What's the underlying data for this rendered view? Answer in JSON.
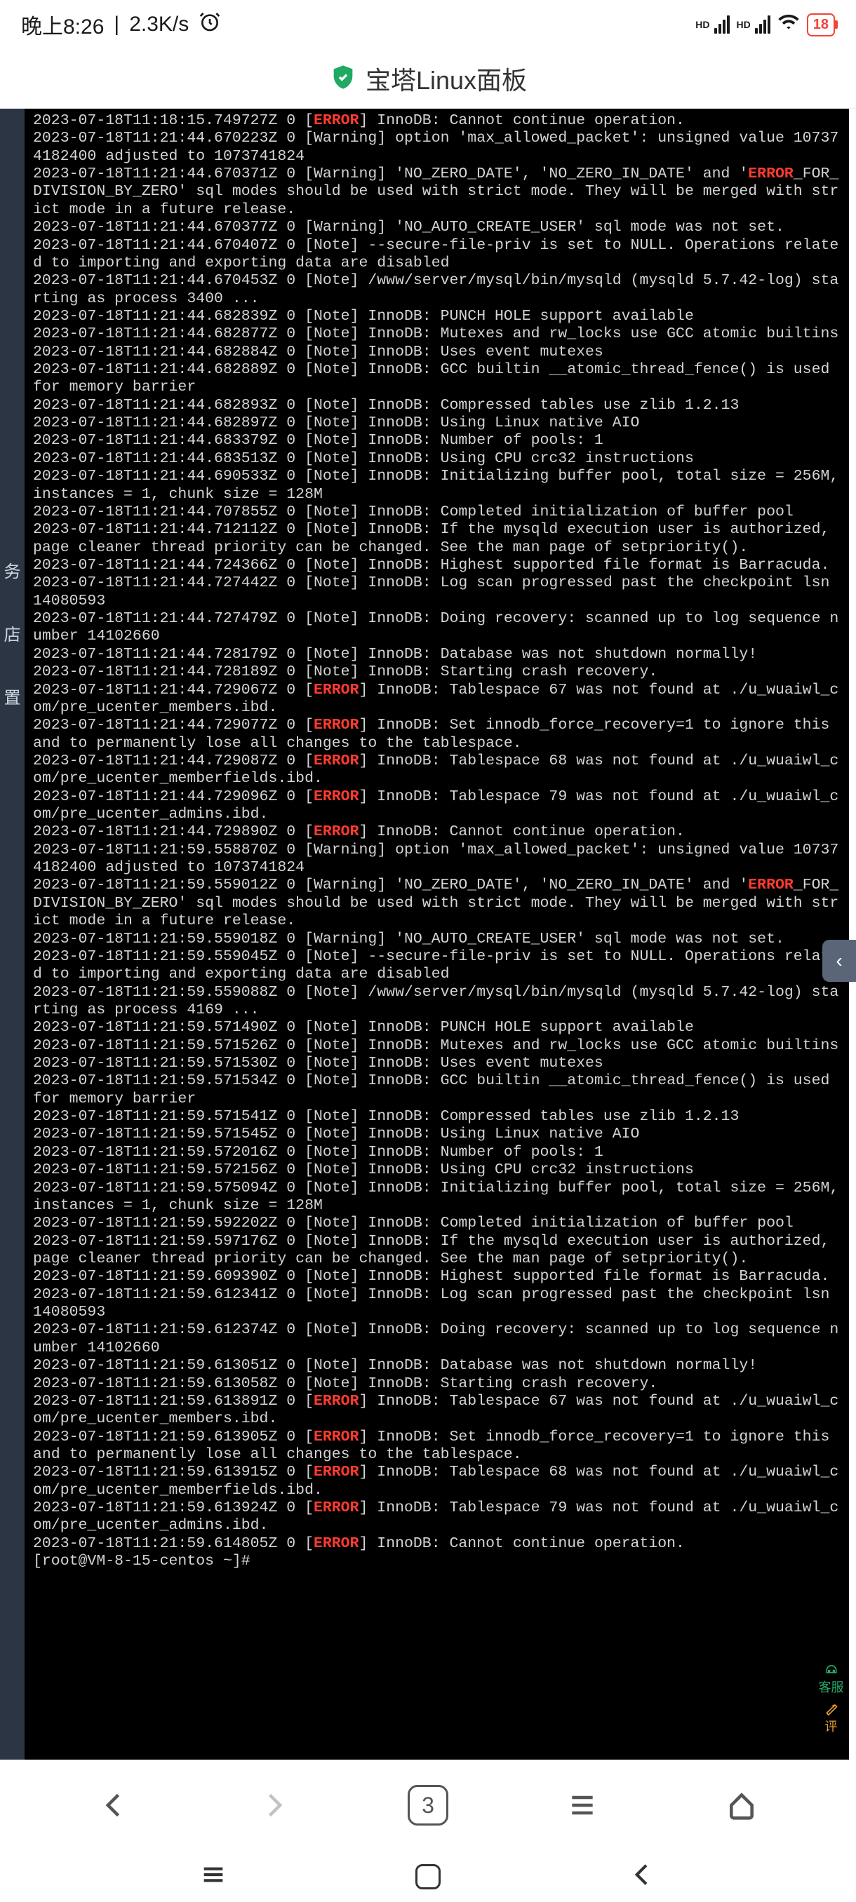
{
  "status": {
    "time": "晚上8:26",
    "speed": "2.3K/s",
    "battery": "18",
    "hd": "HD"
  },
  "title": "宝塔Linux面板",
  "sidebar": {
    "items": [
      "务",
      "店",
      "置"
    ]
  },
  "nav": {
    "tab_count": "3"
  },
  "float": {
    "cs": "客服",
    "review": "评"
  },
  "side_arrow": "‹",
  "log": [
    {
      "t": "2023-07-18T11:18:15.749727Z 0 [",
      "e": "ERROR",
      "r": "] InnoDB: Cannot continue operation."
    },
    {
      "t": "2023-07-18T11:21:44.670223Z 0 [Warning] option 'max_allowed_packet': unsigned value 107374182400 adjusted to 1073741824"
    },
    {
      "t": "2023-07-18T11:21:44.670371Z 0 [Warning] 'NO_ZERO_DATE', 'NO_ZERO_IN_DATE' and '",
      "ew": "ERROR",
      "r2": "_FOR_DIVISION_BY_ZERO' sql modes should be used with strict mode. They will be merged with strict mode in a future release."
    },
    {
      "t": "2023-07-18T11:21:44.670377Z 0 [Warning] 'NO_AUTO_CREATE_USER' sql mode was not set."
    },
    {
      "t": "2023-07-18T11:21:44.670407Z 0 [Note] --secure-file-priv is set to NULL. Operations related to importing and exporting data are disabled"
    },
    {
      "t": "2023-07-18T11:21:44.670453Z 0 [Note] /www/server/mysql/bin/mysqld (mysqld 5.7.42-log) starting as process 3400 ..."
    },
    {
      "t": "2023-07-18T11:21:44.682839Z 0 [Note] InnoDB: PUNCH HOLE support available"
    },
    {
      "t": "2023-07-18T11:21:44.682877Z 0 [Note] InnoDB: Mutexes and rw_locks use GCC atomic builtins"
    },
    {
      "t": "2023-07-18T11:21:44.682884Z 0 [Note] InnoDB: Uses event mutexes"
    },
    {
      "t": "2023-07-18T11:21:44.682889Z 0 [Note] InnoDB: GCC builtin __atomic_thread_fence() is used for memory barrier"
    },
    {
      "t": "2023-07-18T11:21:44.682893Z 0 [Note] InnoDB: Compressed tables use zlib 1.2.13"
    },
    {
      "t": "2023-07-18T11:21:44.682897Z 0 [Note] InnoDB: Using Linux native AIO"
    },
    {
      "t": "2023-07-18T11:21:44.683379Z 0 [Note] InnoDB: Number of pools: 1"
    },
    {
      "t": "2023-07-18T11:21:44.683513Z 0 [Note] InnoDB: Using CPU crc32 instructions"
    },
    {
      "t": "2023-07-18T11:21:44.690533Z 0 [Note] InnoDB: Initializing buffer pool, total size = 256M, instances = 1, chunk size = 128M"
    },
    {
      "t": "2023-07-18T11:21:44.707855Z 0 [Note] InnoDB: Completed initialization of buffer pool"
    },
    {
      "t": "2023-07-18T11:21:44.712112Z 0 [Note] InnoDB: If the mysqld execution user is authorized, page cleaner thread priority can be changed. See the man page of setpriority()."
    },
    {
      "t": "2023-07-18T11:21:44.724366Z 0 [Note] InnoDB: Highest supported file format is Barracuda."
    },
    {
      "t": "2023-07-18T11:21:44.727442Z 0 [Note] InnoDB: Log scan progressed past the checkpoint lsn 14080593"
    },
    {
      "t": "2023-07-18T11:21:44.727479Z 0 [Note] InnoDB: Doing recovery: scanned up to log sequence number 14102660"
    },
    {
      "t": "2023-07-18T11:21:44.728179Z 0 [Note] InnoDB: Database was not shutdown normally!"
    },
    {
      "t": "2023-07-18T11:21:44.728189Z 0 [Note] InnoDB: Starting crash recovery."
    },
    {
      "t": "2023-07-18T11:21:44.729067Z 0 [",
      "e": "ERROR",
      "r": "] InnoDB: Tablespace 67 was not found at ./u_wuaiwl_com/pre_ucenter_members.ibd."
    },
    {
      "t": "2023-07-18T11:21:44.729077Z 0 [",
      "e": "ERROR",
      "r": "] InnoDB: Set innodb_force_recovery=1 to ignore this and to permanently lose all changes to the tablespace."
    },
    {
      "t": "2023-07-18T11:21:44.729087Z 0 [",
      "e": "ERROR",
      "r": "] InnoDB: Tablespace 68 was not found at ./u_wuaiwl_com/pre_ucenter_memberfields.ibd."
    },
    {
      "t": "2023-07-18T11:21:44.729096Z 0 [",
      "e": "ERROR",
      "r": "] InnoDB: Tablespace 79 was not found at ./u_wuaiwl_com/pre_ucenter_admins.ibd."
    },
    {
      "t": "2023-07-18T11:21:44.729890Z 0 [",
      "e": "ERROR",
      "r": "] InnoDB: Cannot continue operation."
    },
    {
      "t": "2023-07-18T11:21:59.558870Z 0 [Warning] option 'max_allowed_packet': unsigned value 107374182400 adjusted to 1073741824"
    },
    {
      "t": "2023-07-18T11:21:59.559012Z 0 [Warning] 'NO_ZERO_DATE', 'NO_ZERO_IN_DATE' and '",
      "ew": "ERROR",
      "r2": "_FOR_DIVISION_BY_ZERO' sql modes should be used with strict mode. They will be merged with strict mode in a future release."
    },
    {
      "t": "2023-07-18T11:21:59.559018Z 0 [Warning] 'NO_AUTO_CREATE_USER' sql mode was not set."
    },
    {
      "t": "2023-07-18T11:21:59.559045Z 0 [Note] --secure-file-priv is set to NULL. Operations related to importing and exporting data are disabled"
    },
    {
      "t": "2023-07-18T11:21:59.559088Z 0 [Note] /www/server/mysql/bin/mysqld (mysqld 5.7.42-log) starting as process 4169 ..."
    },
    {
      "t": "2023-07-18T11:21:59.571490Z 0 [Note] InnoDB: PUNCH HOLE support available"
    },
    {
      "t": "2023-07-18T11:21:59.571526Z 0 [Note] InnoDB: Mutexes and rw_locks use GCC atomic builtins"
    },
    {
      "t": "2023-07-18T11:21:59.571530Z 0 [Note] InnoDB: Uses event mutexes"
    },
    {
      "t": "2023-07-18T11:21:59.571534Z 0 [Note] InnoDB: GCC builtin __atomic_thread_fence() is used for memory barrier"
    },
    {
      "t": "2023-07-18T11:21:59.571541Z 0 [Note] InnoDB: Compressed tables use zlib 1.2.13"
    },
    {
      "t": "2023-07-18T11:21:59.571545Z 0 [Note] InnoDB: Using Linux native AIO"
    },
    {
      "t": "2023-07-18T11:21:59.572016Z 0 [Note] InnoDB: Number of pools: 1"
    },
    {
      "t": "2023-07-18T11:21:59.572156Z 0 [Note] InnoDB: Using CPU crc32 instructions"
    },
    {
      "t": "2023-07-18T11:21:59.575094Z 0 [Note] InnoDB: Initializing buffer pool, total size = 256M, instances = 1, chunk size = 128M"
    },
    {
      "t": "2023-07-18T11:21:59.592202Z 0 [Note] InnoDB: Completed initialization of buffer pool"
    },
    {
      "t": "2023-07-18T11:21:59.597176Z 0 [Note] InnoDB: If the mysqld execution user is authorized, page cleaner thread priority can be changed. See the man page of setpriority()."
    },
    {
      "t": "2023-07-18T11:21:59.609390Z 0 [Note] InnoDB: Highest supported file format is Barracuda."
    },
    {
      "t": "2023-07-18T11:21:59.612341Z 0 [Note] InnoDB: Log scan progressed past the checkpoint lsn 14080593"
    },
    {
      "t": "2023-07-18T11:21:59.612374Z 0 [Note] InnoDB: Doing recovery: scanned up to log sequence number 14102660"
    },
    {
      "t": "2023-07-18T11:21:59.613051Z 0 [Note] InnoDB: Database was not shutdown normally!"
    },
    {
      "t": "2023-07-18T11:21:59.613058Z 0 [Note] InnoDB: Starting crash recovery."
    },
    {
      "t": "2023-07-18T11:21:59.613891Z 0 [",
      "e": "ERROR",
      "r": "] InnoDB: Tablespace 67 was not found at ./u_wuaiwl_com/pre_ucenter_members.ibd."
    },
    {
      "t": "2023-07-18T11:21:59.613905Z 0 [",
      "e": "ERROR",
      "r": "] InnoDB: Set innodb_force_recovery=1 to ignore this and to permanently lose all changes to the tablespace."
    },
    {
      "t": "2023-07-18T11:21:59.613915Z 0 [",
      "e": "ERROR",
      "r": "] InnoDB: Tablespace 68 was not found at ./u_wuaiwl_com/pre_ucenter_memberfields.ibd."
    },
    {
      "t": "2023-07-18T11:21:59.613924Z 0 [",
      "e": "ERROR",
      "r": "] InnoDB: Tablespace 79 was not found at ./u_wuaiwl_com/pre_ucenter_admins.ibd."
    },
    {
      "t": "2023-07-18T11:21:59.614805Z 0 [",
      "e": "ERROR",
      "r": "] InnoDB: Cannot continue operation."
    },
    {
      "t": "[root@VM-8-15-centos ~]#"
    }
  ]
}
